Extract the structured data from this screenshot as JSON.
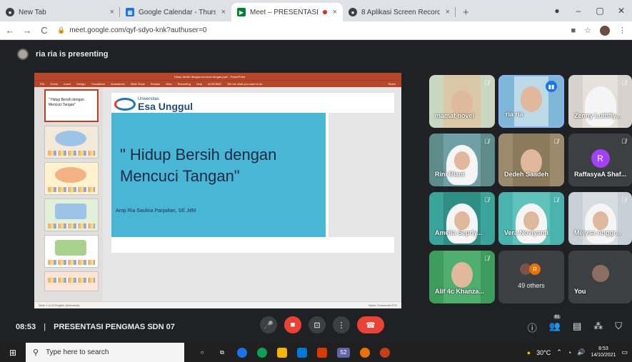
{
  "browser": {
    "tabs": [
      {
        "label": "New Tab",
        "close": "×",
        "favicon": "github-icon",
        "color": "#3c4043"
      },
      {
        "label": "Google Calendar - Thursday, 14 O",
        "close": "×",
        "favicon": "calendar-icon",
        "color": "#1a73e8"
      },
      {
        "label": "Meet – PRESENTASI PENGMA",
        "close": "×",
        "favicon": "meet-icon",
        "color": "#00832d",
        "active": true
      },
      {
        "label": "8 Aplikasi Screen Recorder Lapto",
        "close": "×",
        "favicon": "github-icon",
        "color": "#3c4043"
      }
    ],
    "new_tab": "+",
    "window_controls": {
      "minimize": "–",
      "maximize": "▢",
      "close": "✕",
      "menu": "●"
    },
    "nav": {
      "back": "←",
      "forward": "→",
      "reload": "C"
    },
    "url": "meet.google.com/qyf-sdyo-knk?authuser=0",
    "addr_icons": {
      "camera": "■",
      "star": "☆",
      "menu": "⋮"
    }
  },
  "meet": {
    "presenter_label": "ria ria is presenting",
    "meeting_time": "08:53",
    "meeting_title": "PRESENTASI PENGMAS SDN 07",
    "divider": "|",
    "participants_badge": "61"
  },
  "powerpoint": {
    "title_text": "Hidup bersih dengan mencuci tangan.pptx  -  PowerPoint",
    "ribbon_tabs": [
      "File",
      "Home",
      "Insert",
      "Design",
      "Transitions",
      "Animations",
      "Slide Show",
      "Review",
      "View",
      "Recording",
      "Help",
      "ACROBAT",
      "Tell me what you want to do"
    ],
    "share": "Share",
    "thumb_numbers": [
      "1",
      "2",
      "3",
      "4",
      "5",
      "6"
    ],
    "thumb1_text": "\" Hidup Bersih dengan Mencuci Tangan\"",
    "status_left": "Slide 1 of 13    English (Indonesia)",
    "status_right": "Notes   Comments      57%",
    "slide": {
      "logo_small": "Universitas",
      "logo_big": "Esa Unggul",
      "title": "\" Hidup Bersih dengan Mencuci Tangan\"",
      "author": "Arop Ria Saulina Panjaitan, SE.,MM"
    }
  },
  "participants": [
    {
      "name": "mamat novel",
      "muted": true
    },
    {
      "name": "ria ria",
      "speaking": true
    },
    {
      "name": "Zenny Luthfiy...",
      "muted": true
    },
    {
      "name": "Rini Riani",
      "muted": true
    },
    {
      "name": "Dedeh Saadeh",
      "muted": true
    },
    {
      "name": "RaffasyaA Shaf...",
      "muted": true,
      "initial": "R"
    },
    {
      "name": "Amelia Sepriy...",
      "muted": true
    },
    {
      "name": "Vera Noviyanti",
      "muted": true
    },
    {
      "name": "Melysa Anggr...",
      "muted": true
    },
    {
      "name": "Alif 4c Khanza...",
      "muted": true
    },
    {
      "name": "49 others",
      "others_initial": "R"
    },
    {
      "name": "You"
    }
  ],
  "taskbar": {
    "search_placeholder": "Type here to search",
    "weather": "30°C",
    "time": "8:53",
    "date": "14/10/2021",
    "badge": "52"
  },
  "colors": {
    "meet_bg": "#202124",
    "accent_blue": "#1a73e8",
    "hangup_red": "#ea4335",
    "ppt_red": "#b7472a",
    "slide_blue": "#49b6d6"
  }
}
